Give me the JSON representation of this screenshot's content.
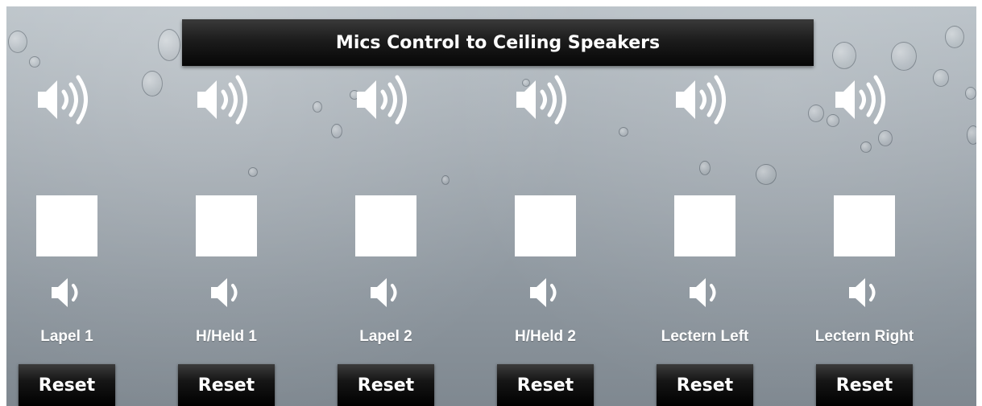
{
  "panel": {
    "title": "Mics Control to Ceiling Speakers"
  },
  "channels": [
    {
      "label": "Lapel 1",
      "reset_label": "Reset"
    },
    {
      "label": "H/Held 1",
      "reset_label": "Reset"
    },
    {
      "label": "Lapel 2",
      "reset_label": "Reset"
    },
    {
      "label": "H/Held 2",
      "reset_label": "Reset"
    },
    {
      "label": "Lectern Left",
      "reset_label": "Reset"
    },
    {
      "label": "Lectern Right",
      "reset_label": "Reset"
    }
  ],
  "icons": {
    "volume_up": "speaker-loud-icon",
    "volume_down": "speaker-quiet-icon"
  },
  "colors": {
    "title_bar": "#111111",
    "reset_button": "#000000",
    "label_text": "#ffffff",
    "level_box": "#ffffff"
  }
}
